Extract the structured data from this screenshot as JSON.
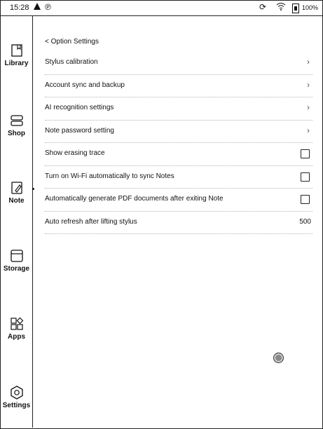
{
  "status": {
    "time": "15:28",
    "battery_pct": "100%"
  },
  "sidebar": {
    "items": [
      {
        "label": "Library",
        "icon": "book-icon"
      },
      {
        "label": "Shop",
        "icon": "shop-icon"
      },
      {
        "label": "Note",
        "icon": "note-pen-icon"
      },
      {
        "label": "Storage",
        "icon": "storage-icon"
      },
      {
        "label": "Apps",
        "icon": "apps-grid-icon"
      },
      {
        "label": "Settings",
        "icon": "hexagon-gear-icon"
      }
    ],
    "active": "Note"
  },
  "page": {
    "back_label": "< Option Settings"
  },
  "rows": [
    {
      "label": "Stylus calibration",
      "control": "chevron"
    },
    {
      "label": "Account sync and backup",
      "control": "chevron"
    },
    {
      "label": "AI recognition settings",
      "control": "chevron"
    },
    {
      "label": "Note password setting",
      "control": "chevron"
    },
    {
      "label": "Show erasing trace",
      "control": "checkbox",
      "checked": false
    },
    {
      "label": "Turn on Wi-Fi automatically to sync Notes",
      "control": "checkbox",
      "checked": false
    },
    {
      "label": "Automatically generate PDF documents after exiting Note",
      "control": "checkbox",
      "checked": false
    },
    {
      "label": "Auto refresh after lifting stylus",
      "control": "value",
      "value": "500"
    }
  ]
}
